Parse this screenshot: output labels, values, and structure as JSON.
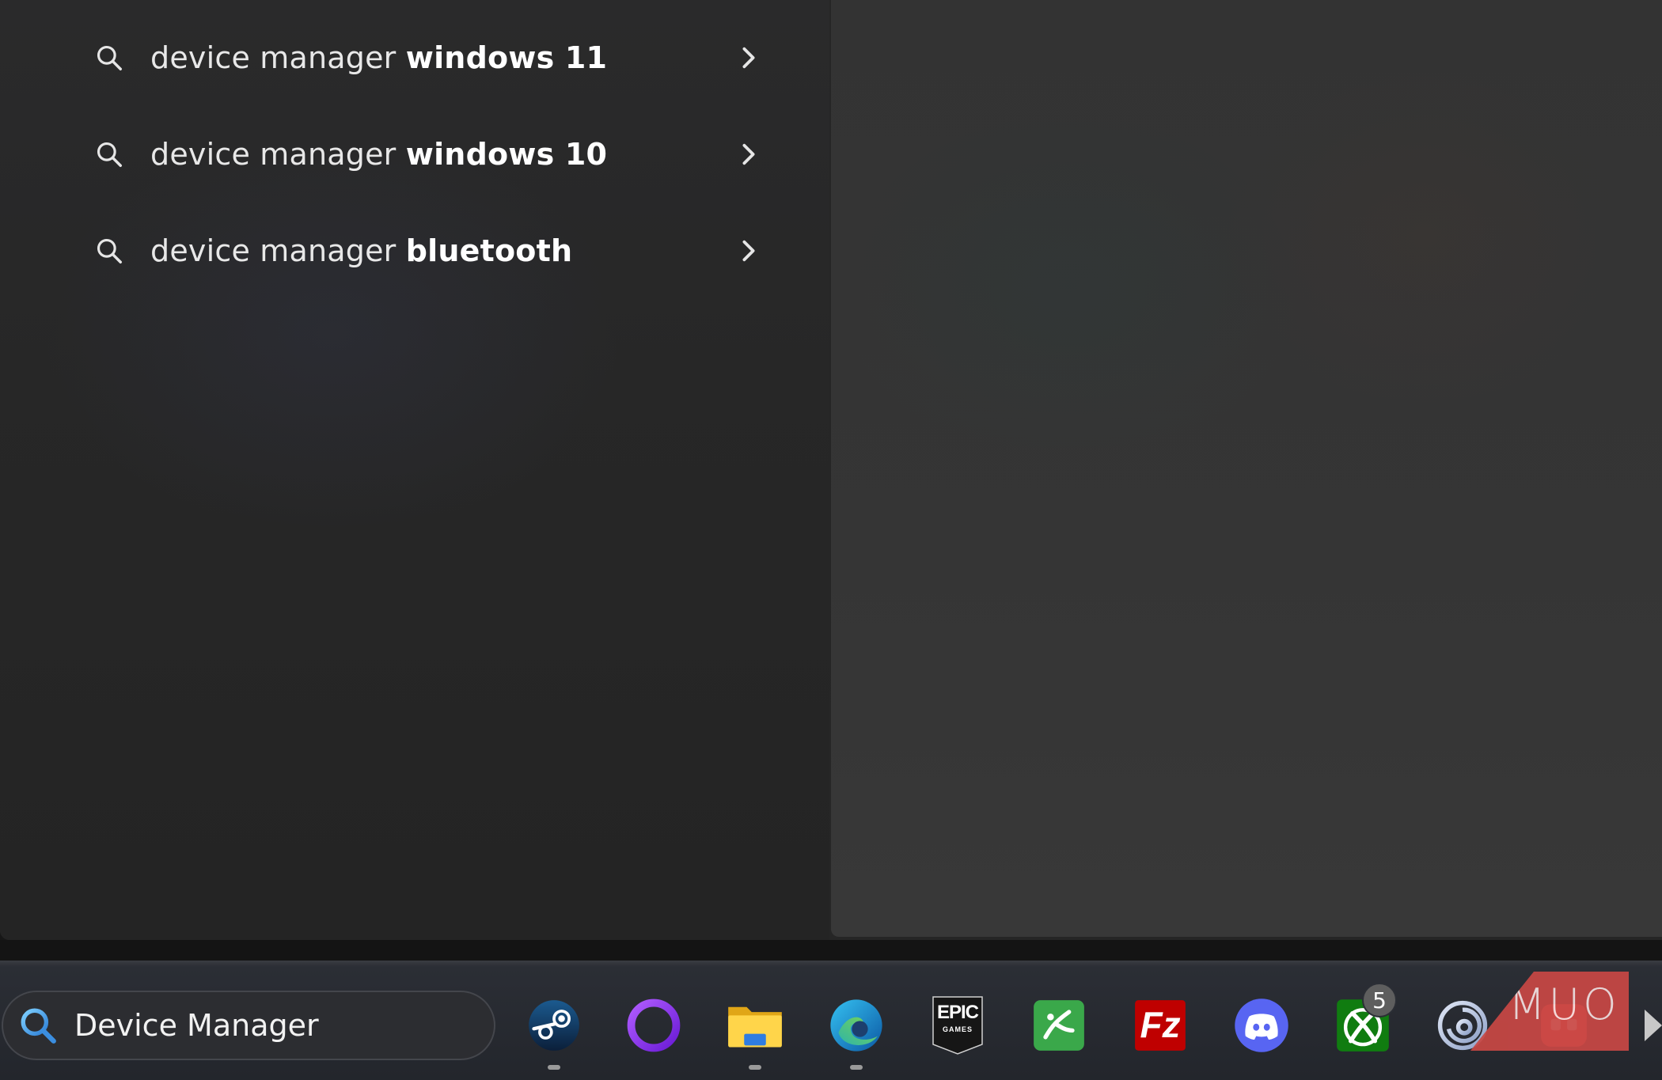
{
  "search_flyout": {
    "suggestions": [
      {
        "prefix": "device manager ",
        "suffix": "windows 11"
      },
      {
        "prefix": "device manager ",
        "suffix": "windows 10"
      },
      {
        "prefix": "device manager ",
        "suffix": "bluetooth"
      }
    ]
  },
  "taskbar": {
    "search_value": "Device Manager",
    "apps": [
      {
        "name": "steam",
        "icon": "steam-icon",
        "running": true
      },
      {
        "name": "cortana-ring",
        "icon": "ring-icon",
        "running": false
      },
      {
        "name": "file-explorer",
        "icon": "folder-icon",
        "running": true
      },
      {
        "name": "microsoft-edge",
        "icon": "edge-icon",
        "running": true
      },
      {
        "name": "epic-games",
        "icon": "epic-games-icon",
        "running": false
      },
      {
        "name": "green-app",
        "icon": "green-app-icon",
        "running": false
      },
      {
        "name": "filezilla",
        "icon": "filezilla-icon",
        "running": false
      },
      {
        "name": "discord",
        "icon": "discord-icon",
        "running": false
      },
      {
        "name": "xbox",
        "icon": "xbox-icon",
        "running": false,
        "badge": "5"
      },
      {
        "name": "ubisoft-connect",
        "icon": "ubisoft-icon",
        "running": false
      },
      {
        "name": "red-app",
        "icon": "red-app-icon",
        "running": false
      }
    ],
    "epic_label_top": "EPIC",
    "epic_label_bottom": "GAMES",
    "filezilla_label": "Fz"
  },
  "watermark": {
    "text": "MUO"
  },
  "colors": {
    "accent_search_icon": "#4aa3e8",
    "discord": "#5865f2",
    "xbox": "#107c10",
    "filezilla": "#bf0000",
    "ring": "#8a2be2"
  }
}
